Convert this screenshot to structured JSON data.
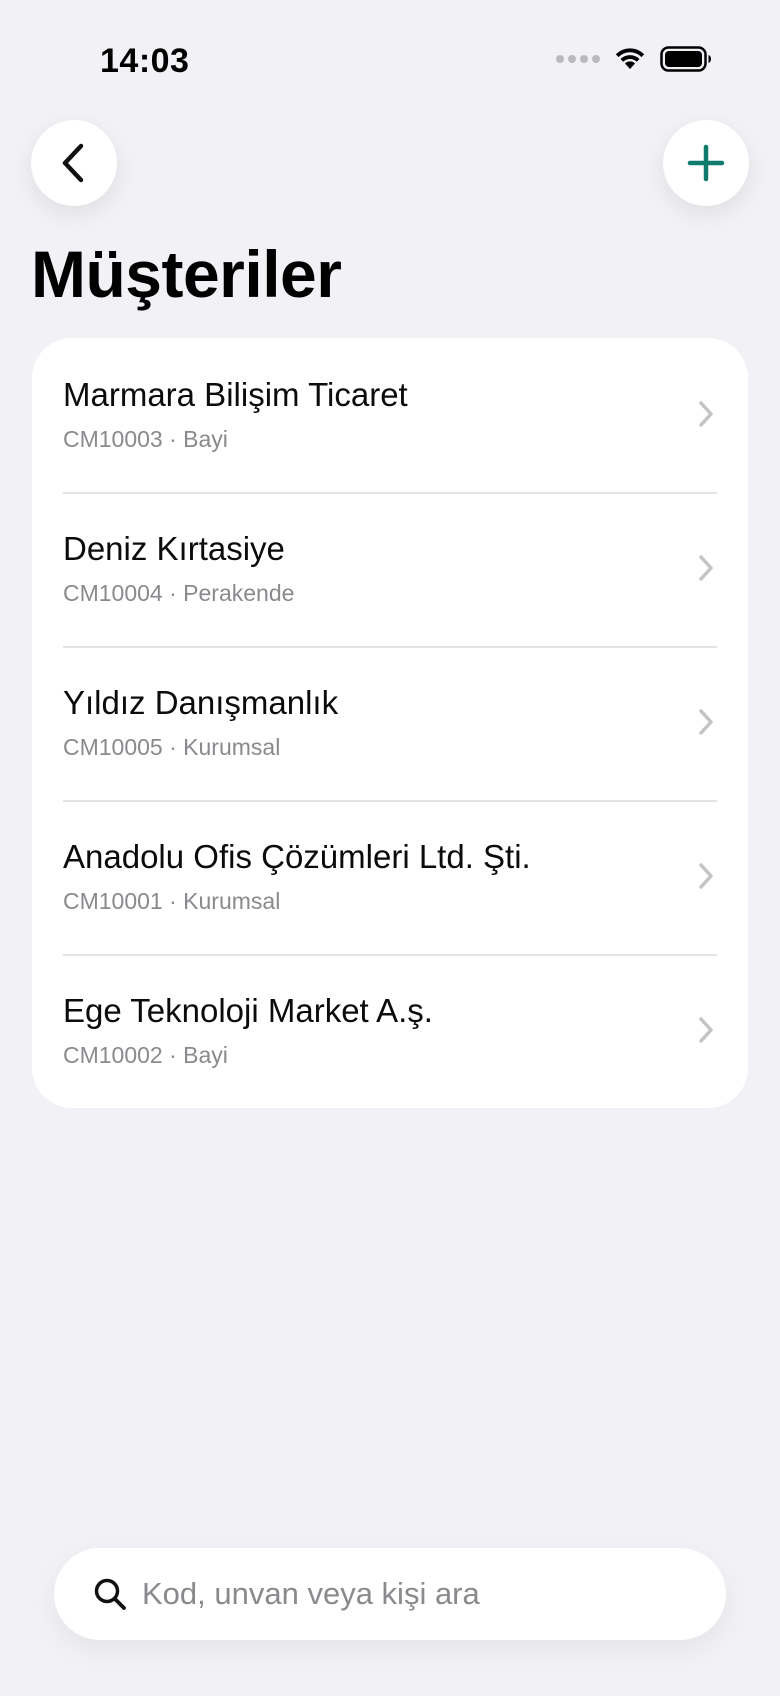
{
  "status_bar": {
    "time": "14:03"
  },
  "header": {
    "back_icon": "chevron-left-icon",
    "add_icon": "plus-icon",
    "title": "Müşteriler"
  },
  "colors": {
    "accent": "#0f7b6c",
    "background": "#f2f2f6",
    "secondary_text": "#8a8a8e",
    "chevron": "#c4c4c7"
  },
  "customers": [
    {
      "name": "Marmara Bilişim Ticaret",
      "subtitle": "CM10003 · Bayi"
    },
    {
      "name": "Deniz Kırtasiye",
      "subtitle": "CM10004 · Perakende"
    },
    {
      "name": "Yıldız Danışmanlık",
      "subtitle": "CM10005 · Kurumsal"
    },
    {
      "name": "Anadolu Ofis Çözümleri Ltd. Şti.",
      "subtitle": "CM10001 · Kurumsal"
    },
    {
      "name": "Ege Teknoloji Market A.ş.",
      "subtitle": "CM10002 · Bayi"
    }
  ],
  "search": {
    "icon": "search-icon",
    "placeholder": "Kod, unvan veya kişi ara",
    "value": ""
  }
}
